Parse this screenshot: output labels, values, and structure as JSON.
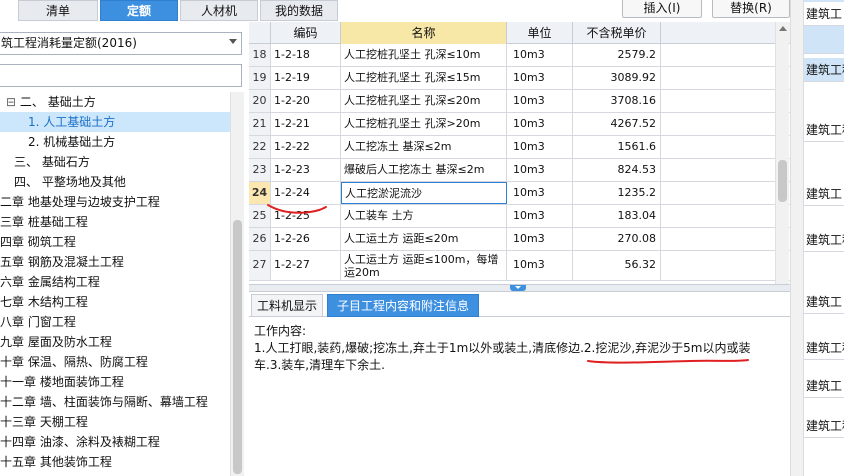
{
  "top_tabs": [
    "清单",
    "定额",
    "人材机",
    "我的数据"
  ],
  "active_tab": 1,
  "buttons": {
    "insert": "插入(I)",
    "replace": "替换(R)"
  },
  "quota_library": "筑工程消耗量定额(2016)",
  "tree": [
    {
      "label": "二、 基础土方",
      "indent": 0
    },
    {
      "label": "1. 人工基础土方",
      "indent": 2,
      "selected": true
    },
    {
      "label": "2. 机械基础土方",
      "indent": 2
    },
    {
      "label": "三、 基础石方",
      "indent": 1
    },
    {
      "label": "四、 平整场地及其他",
      "indent": 1
    },
    {
      "label": "二章 地基处理与边坡支护工程",
      "indent": -1
    },
    {
      "label": "三章 桩基础工程",
      "indent": -1
    },
    {
      "label": "四章 砌筑工程",
      "indent": -1
    },
    {
      "label": "五章 钢筋及混凝土工程",
      "indent": -1
    },
    {
      "label": "六章 金属结构工程",
      "indent": -1
    },
    {
      "label": "七章 木结构工程",
      "indent": -1
    },
    {
      "label": "八章 门窗工程",
      "indent": -1
    },
    {
      "label": "九章 屋面及防水工程",
      "indent": -1
    },
    {
      "label": "十章 保温、隔热、防腐工程",
      "indent": -1
    },
    {
      "label": "十一章 楼地面装饰工程",
      "indent": -1
    },
    {
      "label": "十二章 墙、柱面装饰与隔断、幕墙工程",
      "indent": -1
    },
    {
      "label": "十三章 天棚工程",
      "indent": -1
    },
    {
      "label": "十四章 油漆、涂料及裱糊工程",
      "indent": -1
    },
    {
      "label": "十五章 其他装饰工程",
      "indent": -1
    }
  ],
  "grid": {
    "headers": [
      "编码",
      "名称",
      "单位",
      "不含税单价"
    ],
    "rows": [
      {
        "no": "18",
        "code": "1-2-18",
        "name": "人工挖桩孔坚土 孔深≤10m",
        "unit": "10m3",
        "price": "2579.2"
      },
      {
        "no": "19",
        "code": "1-2-19",
        "name": "人工挖桩孔坚土 孔深≤15m",
        "unit": "10m3",
        "price": "3089.92"
      },
      {
        "no": "20",
        "code": "1-2-20",
        "name": "人工挖桩孔坚土 孔深≤20m",
        "unit": "10m3",
        "price": "3708.16"
      },
      {
        "no": "21",
        "code": "1-2-21",
        "name": "人工挖桩孔坚土 孔深>20m",
        "unit": "10m3",
        "price": "4267.52"
      },
      {
        "no": "22",
        "code": "1-2-22",
        "name": "人工挖冻土 基深≤2m",
        "unit": "10m3",
        "price": "1561.6"
      },
      {
        "no": "23",
        "code": "1-2-23",
        "name": "爆破后人工挖冻土 基深≤2m",
        "unit": "10m3",
        "price": "824.53"
      },
      {
        "no": "24",
        "code": "1-2-24",
        "name": "人工挖淤泥流沙",
        "unit": "10m3",
        "price": "1235.2",
        "current": true
      },
      {
        "no": "25",
        "code": "1-2-25",
        "name": "人工装车 土方",
        "unit": "10m3",
        "price": "183.04"
      },
      {
        "no": "26",
        "code": "1-2-26",
        "name": "人工运土方 运距≤20m",
        "unit": "10m3",
        "price": "270.08"
      },
      {
        "no": "27",
        "code": "1-2-27",
        "name": "人工运土方 运距≤100m，每增运20m",
        "unit": "10m3",
        "price": "56.32",
        "tall": true
      }
    ]
  },
  "bottom_tabs": [
    "工料机显示",
    "子目工程内容和附注信息"
  ],
  "bottom_active": 1,
  "work_content_label": "工作内容:",
  "work_content": "1.人工打眼,装药,爆破;挖冻土,弃土于1m以外或装土,清底修边.2.挖泥沙,弃泥沙于5m以内或装车.3.装车,清理车下余土.",
  "right_cells": [
    "建筑工",
    "建筑工程",
    "建筑工程",
    "建筑工",
    "建筑工程",
    "建筑工",
    "建筑工程",
    "建筑工",
    "建筑工程"
  ],
  "colors": {
    "accent": "#3d8fe0",
    "selected_bg": "#cce6fb",
    "header_name": "#f7e8a8",
    "annotation": "#e02020"
  }
}
